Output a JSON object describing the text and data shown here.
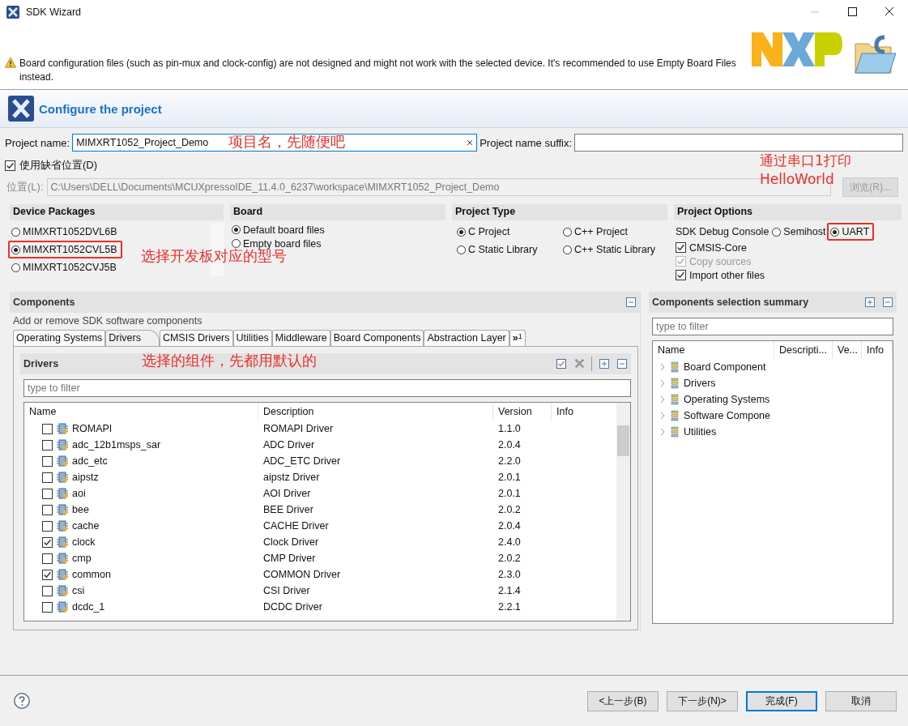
{
  "window": {
    "title": "SDK Wizard"
  },
  "warning": "Board configuration files (such as pin-mux and clock-config) are not designed and might not work with the selected device. It's recommended to use Empty Board Files instead.",
  "header": {
    "title": "Configure the project"
  },
  "project_name": {
    "label": "Project name:",
    "value": "MIMXRT1052_Project_Demo",
    "suffix_label": "Project name suffix:",
    "annotation": "项目名，先随便吧"
  },
  "default_location": {
    "label": "使用缺省位置(D)",
    "checked": true
  },
  "location": {
    "label": "位置(L):",
    "value": "C:\\Users\\DELL\\Documents\\MCUXpressoIDE_11.4.0_6237\\workspace\\MIMXRT1052_Project_Demo",
    "browse": "浏览(R)..."
  },
  "device_packages": {
    "title": "Device Packages",
    "annotation": "选择开发板对应的型号",
    "items": [
      {
        "label": "MIMXRT1052DVL6B",
        "selected": false,
        "highlighted": false
      },
      {
        "label": "MIMXRT1052CVL5B",
        "selected": true,
        "highlighted": true
      },
      {
        "label": "MIMXRT1052CVJ5B",
        "selected": false,
        "highlighted": false
      }
    ]
  },
  "board": {
    "title": "Board",
    "items": [
      {
        "label": "Default board files",
        "selected": true
      },
      {
        "label": "Empty board files",
        "selected": false
      }
    ]
  },
  "project_type": {
    "title": "Project Type",
    "items": [
      {
        "label": "C Project",
        "selected": true
      },
      {
        "label": "C++ Project",
        "selected": false
      },
      {
        "label": "C Static Library",
        "selected": false
      },
      {
        "label": "C++ Static Library",
        "selected": false
      }
    ]
  },
  "project_options": {
    "title": "Project Options",
    "annotation": "通过串口1打印\nHelloWorld",
    "console_label": "SDK Debug Console",
    "console_options": [
      {
        "label": "Semihost",
        "selected": false,
        "highlighted": false
      },
      {
        "label": "UART",
        "selected": true,
        "highlighted": true
      }
    ],
    "checks": [
      {
        "label": "CMSIS-Core",
        "checked": true,
        "disabled": false
      },
      {
        "label": "Copy sources",
        "checked": true,
        "disabled": true
      },
      {
        "label": "Import other files",
        "checked": true,
        "disabled": false
      }
    ]
  },
  "components": {
    "title": "Components",
    "subtitle": "Add or remove SDK software components",
    "tabs": [
      {
        "label": "Operating Systems",
        "selected": false
      },
      {
        "label": "Drivers",
        "selected": true
      },
      {
        "label": "CMSIS Drivers",
        "selected": false
      },
      {
        "label": "Utilities",
        "selected": false
      },
      {
        "label": "Middleware",
        "selected": false
      },
      {
        "label": "Board Components",
        "selected": false
      },
      {
        "label": "Abstraction Layer",
        "selected": false
      }
    ],
    "overflow": "»",
    "overflow_count": "1",
    "drivers": {
      "title": "Drivers",
      "annotation": "选择的组件，先都用默认的",
      "filter_placeholder": "type to filter",
      "columns": [
        "Name",
        "Description",
        "Version",
        "Info"
      ],
      "rows": [
        {
          "name": "ROMAPI",
          "description": "ROMAPI Driver",
          "version": "1.1.0",
          "checked": false
        },
        {
          "name": "adc_12b1msps_sar",
          "description": "ADC Driver",
          "version": "2.0.4",
          "checked": false
        },
        {
          "name": "adc_etc",
          "description": "ADC_ETC Driver",
          "version": "2.2.0",
          "checked": false
        },
        {
          "name": "aipstz",
          "description": "aipstz Driver",
          "version": "2.0.1",
          "checked": false
        },
        {
          "name": "aoi",
          "description": "AOI Driver",
          "version": "2.0.1",
          "checked": false
        },
        {
          "name": "bee",
          "description": "BEE Driver",
          "version": "2.0.2",
          "checked": false
        },
        {
          "name": "cache",
          "description": "CACHE Driver",
          "version": "2.0.4",
          "checked": false
        },
        {
          "name": "clock",
          "description": "Clock Driver",
          "version": "2.4.0",
          "checked": true
        },
        {
          "name": "cmp",
          "description": "CMP Driver",
          "version": "2.0.2",
          "checked": false
        },
        {
          "name": "common",
          "description": "COMMON Driver",
          "version": "2.3.0",
          "checked": true
        },
        {
          "name": "csi",
          "description": "CSI Driver",
          "version": "2.1.4",
          "checked": false
        },
        {
          "name": "dcdc_1",
          "description": "DCDC Driver",
          "version": "2.2.1",
          "checked": false
        }
      ]
    }
  },
  "summary": {
    "title": "Components selection summary",
    "filter_placeholder": "type to filter",
    "columns": [
      "Name",
      "Descripti...",
      "Ve...",
      "Info"
    ],
    "items": [
      {
        "label": "Board Component"
      },
      {
        "label": "Drivers"
      },
      {
        "label": "Operating Systems"
      },
      {
        "label": "Software Compone"
      },
      {
        "label": "Utilities"
      }
    ]
  },
  "buttons": [
    {
      "label": "<上一步(B)",
      "default": false
    },
    {
      "label": "下一步(N)>",
      "default": false
    },
    {
      "label": "完成(F)",
      "default": true
    },
    {
      "label": "取消",
      "default": false
    }
  ]
}
